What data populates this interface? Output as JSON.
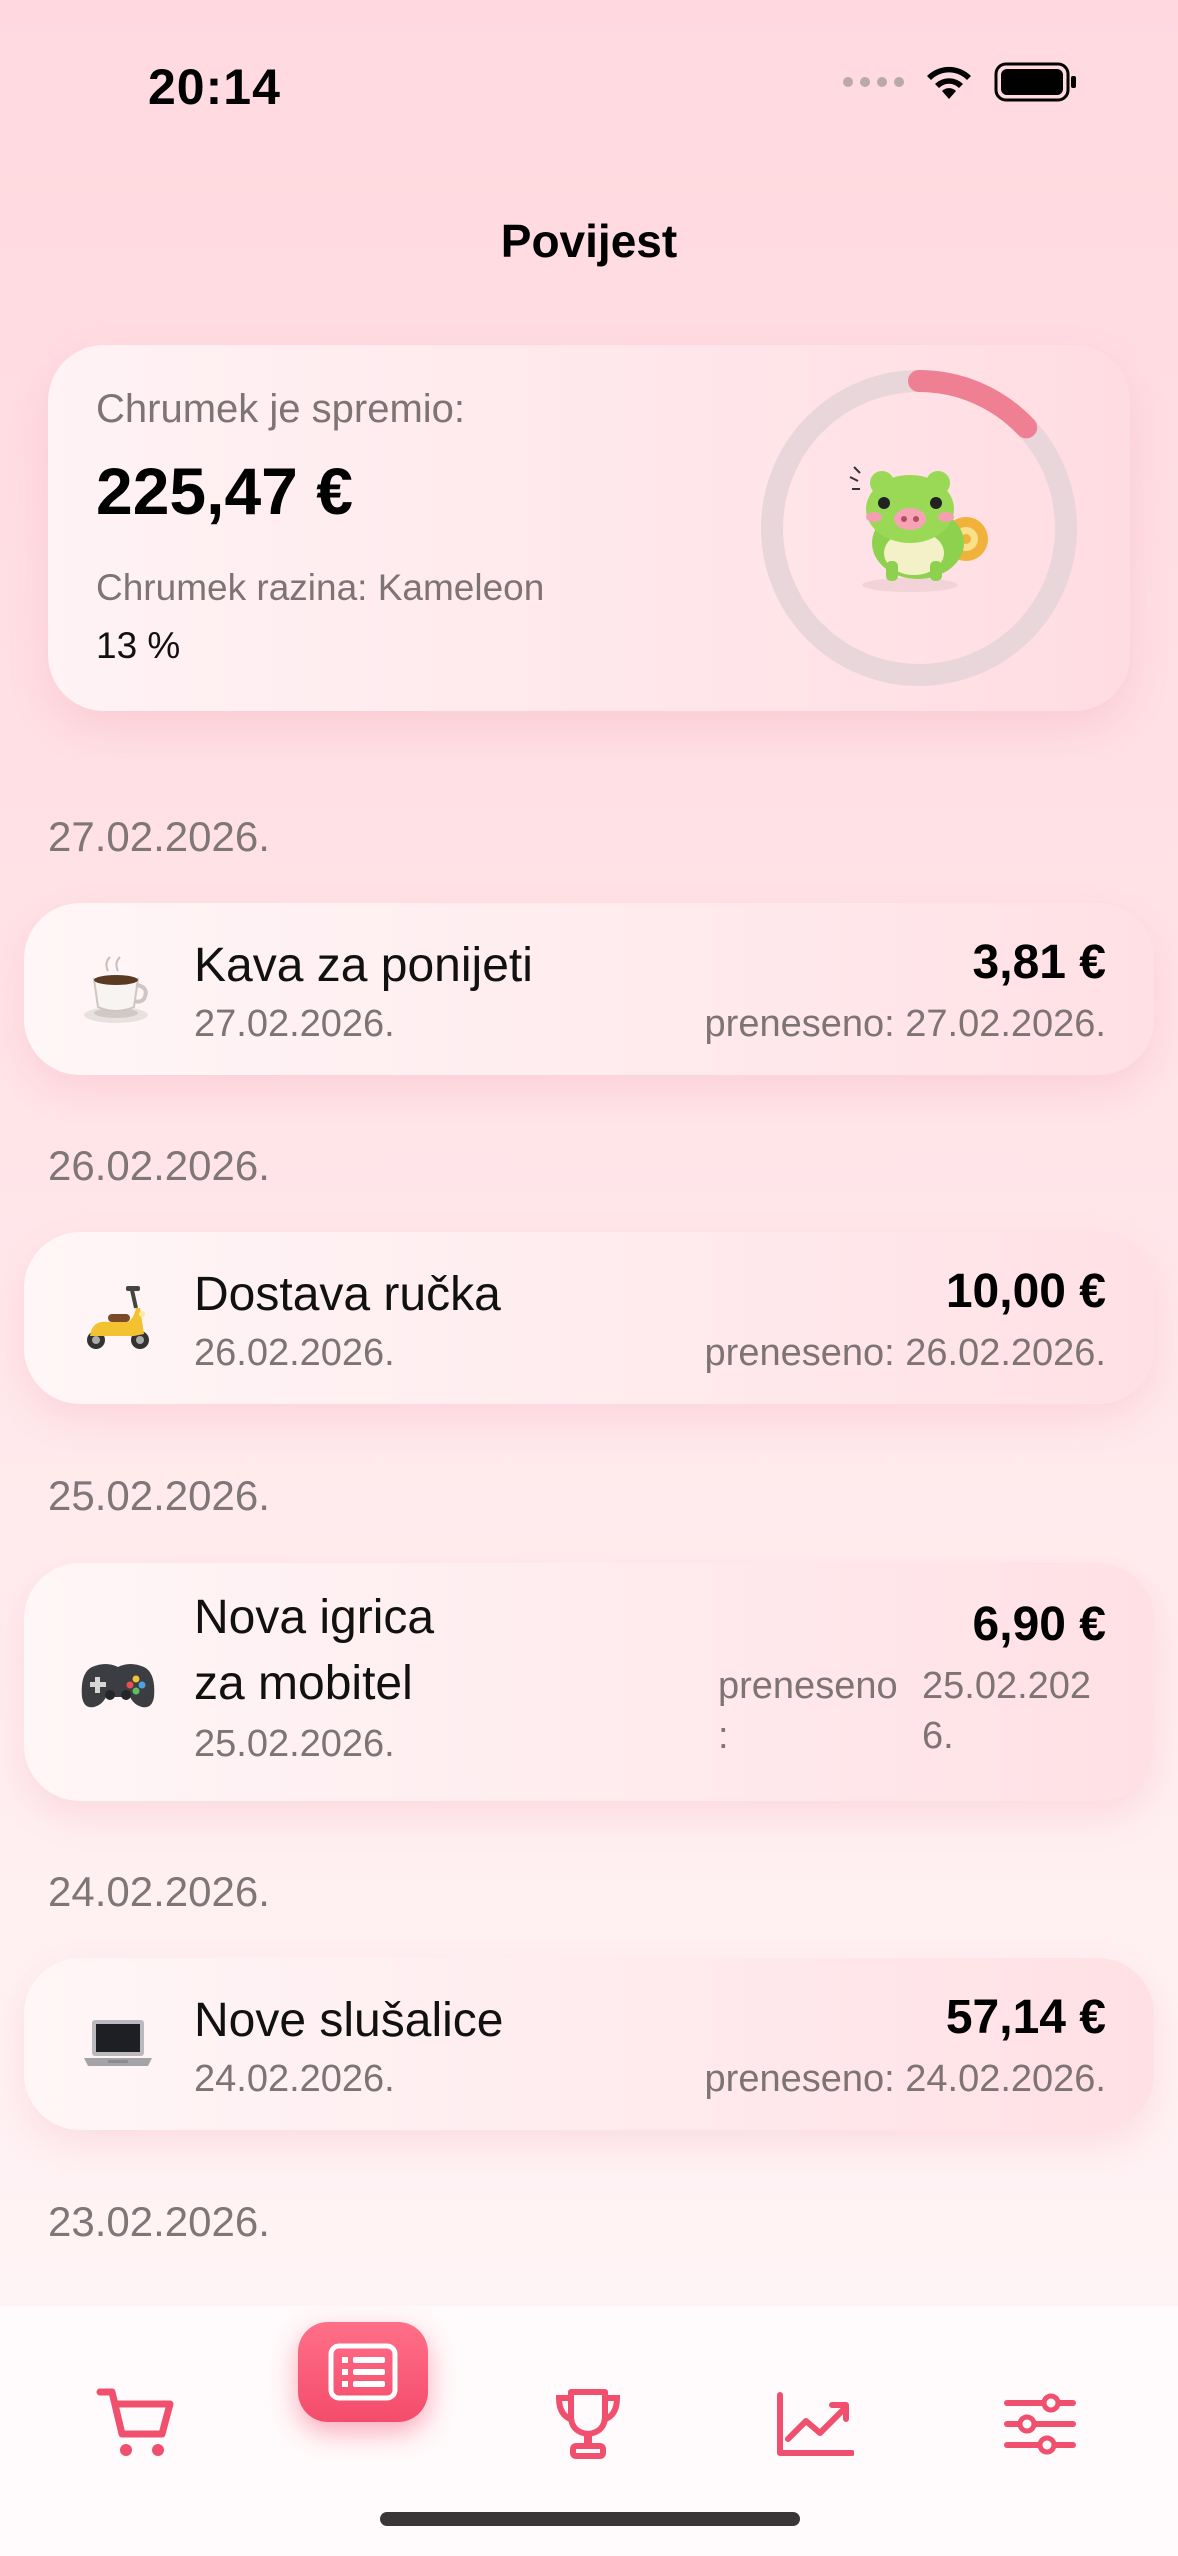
{
  "status_bar": {
    "time": "20:14"
  },
  "page": {
    "title": "Povijest"
  },
  "summary": {
    "label": "Chrumek je spremio:",
    "amount": "225,47 €",
    "level": "Chrumek razina: Kameleon",
    "percent_text": "13 %",
    "progress": 0.13
  },
  "transactions": [
    {
      "group_date": "27.02.2026.",
      "icon": "coffee-icon",
      "name": "Kava za ponijeti",
      "date": "27.02.2026.",
      "amount": "3,81 €",
      "transfer_label": "preneseno:",
      "transfer_date": "27.02.2026."
    },
    {
      "group_date": "26.02.2026.",
      "icon": "scooter-icon",
      "name": "Dostava ručka",
      "date": "26.02.2026.",
      "amount": "10,00 €",
      "transfer_label": "preneseno:",
      "transfer_date": "26.02.2026."
    },
    {
      "group_date": "25.02.2026.",
      "icon": "gamepad-icon",
      "name_line1": "Nova igrica",
      "name_line2": "za mobitel",
      "date": "25.02.2026.",
      "amount": "6,90 €",
      "transfer_label_line1": "preneseno",
      "transfer_label_line2": ":",
      "transfer_date_line1": "25.02.202",
      "transfer_date_line2": "6."
    },
    {
      "group_date": "24.02.2026.",
      "icon": "laptop-icon",
      "name": "Nove slušalice",
      "date": "24.02.2026.",
      "amount": "57,14 €",
      "transfer_label": "preneseno:",
      "transfer_date": "24.02.2026."
    }
  ],
  "next_group_date": "23.02.2026.",
  "tab_bar": {
    "items": [
      "cart-icon",
      "list-icon",
      "trophy-icon",
      "chart-icon",
      "sliders-icon"
    ],
    "active_index": 1
  },
  "colors": {
    "accent": "#f44c6b",
    "ring_track": "#e6d2d6",
    "ring_progress": "#ef7f93"
  }
}
